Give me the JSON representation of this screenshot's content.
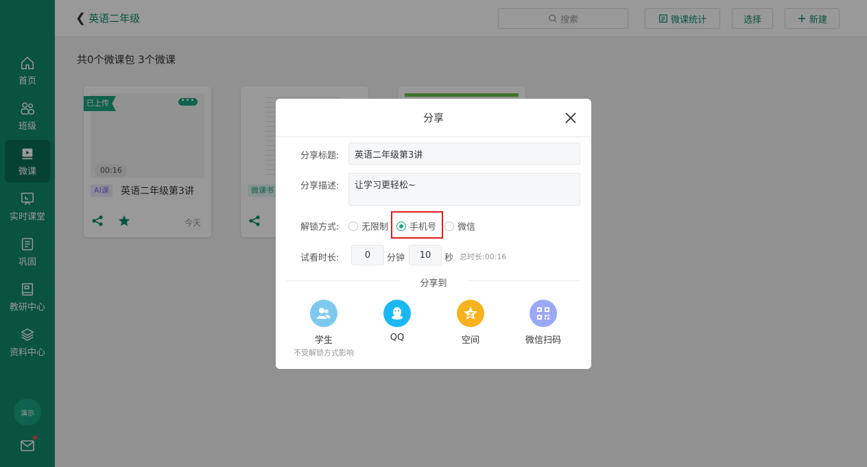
{
  "sidebar": {
    "items": [
      {
        "label": "首页",
        "icon": "home-icon"
      },
      {
        "label": "班级",
        "icon": "people-icon"
      },
      {
        "label": "微课",
        "icon": "play-icon"
      },
      {
        "label": "实时课堂",
        "icon": "screen-icon"
      },
      {
        "label": "巩固",
        "icon": "list-icon"
      },
      {
        "label": "教研中心",
        "icon": "book-icon"
      },
      {
        "label": "资料中心",
        "icon": "layers-icon"
      }
    ],
    "avatar_text": "演示"
  },
  "header": {
    "back_label": "英语二年级",
    "search_placeholder": "搜索",
    "btn_stats": "微课统计",
    "btn_select": "选择",
    "btn_new": "新建"
  },
  "main": {
    "summary": "共0个微课包  3个微课",
    "cards": [
      {
        "status": "已上传",
        "duration": "00:16",
        "badge": "AI课",
        "title": "英语二年级第3讲",
        "date": "今天"
      },
      {
        "badge": "微课书"
      },
      {}
    ]
  },
  "modal": {
    "title": "分享",
    "title_label": "分享标题:",
    "title_value": "英语二年级第3讲",
    "desc_label": "分享描述:",
    "desc_value": "让学习更轻松~",
    "unlock_label": "解锁方式:",
    "unlock_options": [
      "无限制",
      "手机号",
      "微信"
    ],
    "unlock_selected": "手机号",
    "trial_label": "试看时长:",
    "trial_minutes": "0",
    "minute_unit": "分钟",
    "trial_seconds": "10",
    "second_unit": "秒",
    "total_duration": "总时长:00:16",
    "share_to": "分享到",
    "share_targets": [
      {
        "name": "学生",
        "icon": "student-icon",
        "color": "#7ec8f0"
      },
      {
        "name": "QQ",
        "icon": "qq-icon",
        "color": "#1ab8f3"
      },
      {
        "name": "空间",
        "icon": "qzone-star-icon",
        "color": "#f7b21e"
      },
      {
        "name": "微信扫码",
        "icon": "qr-code-icon",
        "color": "#9aa8f7"
      }
    ],
    "student_note": "不受解锁方式影响"
  }
}
